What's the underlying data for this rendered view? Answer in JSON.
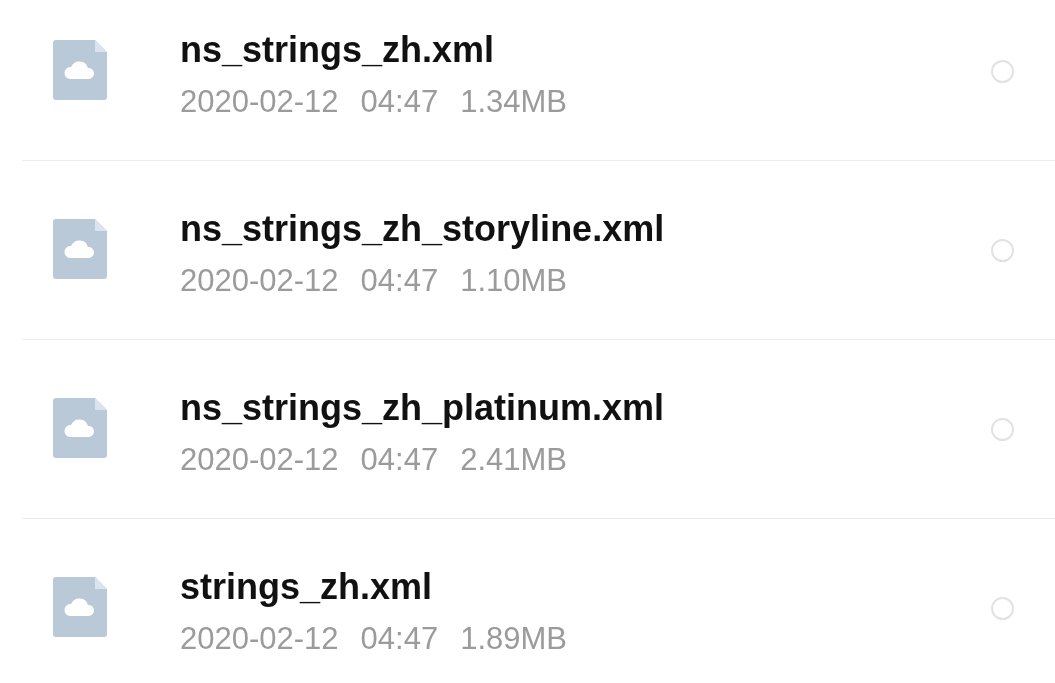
{
  "files": [
    {
      "name": "ns_strings_zh.xml",
      "date": "2020-02-12",
      "time": "04:47",
      "size": "1.34MB",
      "selected": false
    },
    {
      "name": "ns_strings_zh_storyline.xml",
      "date": "2020-02-12",
      "time": "04:47",
      "size": "1.10MB",
      "selected": false
    },
    {
      "name": "ns_strings_zh_platinum.xml",
      "date": "2020-02-12",
      "time": "04:47",
      "size": "2.41MB",
      "selected": false
    },
    {
      "name": "strings_zh.xml",
      "date": "2020-02-12",
      "time": "04:47",
      "size": "1.89MB",
      "selected": false
    }
  ]
}
